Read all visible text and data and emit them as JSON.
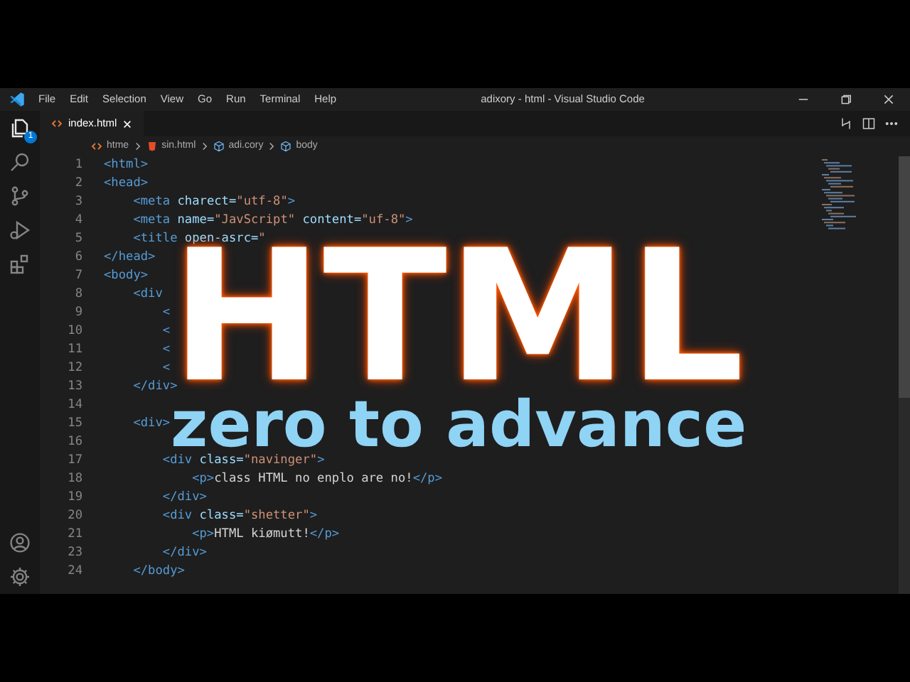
{
  "window": {
    "title": "adixory - html - Visual Studio Code"
  },
  "menu": [
    "File",
    "Edit",
    "Selection",
    "View",
    "Go",
    "Run",
    "Terminal",
    "Help"
  ],
  "activity_bar": {
    "top": [
      {
        "kind": "explorer",
        "selected": true,
        "badge": "1"
      },
      {
        "kind": "search",
        "selected": false
      },
      {
        "kind": "source-control",
        "selected": false
      },
      {
        "kind": "run",
        "selected": false
      },
      {
        "kind": "extensions",
        "selected": false
      }
    ],
    "bottom": [
      {
        "kind": "account"
      },
      {
        "kind": "settings"
      }
    ]
  },
  "tabs": [
    {
      "label": "index.html",
      "selected": true
    }
  ],
  "breadcrumb": [
    {
      "kind": "folder",
      "label": "htme"
    },
    {
      "kind": "file",
      "label": "sin.html"
    },
    {
      "kind": "symbol",
      "label": "adi.cory"
    },
    {
      "kind": "symbol",
      "label": "body"
    }
  ],
  "editor": {
    "lines": [
      {
        "number": "1",
        "tokens": [
          {
            "kind": "tag",
            "text": "<html>"
          }
        ]
      },
      {
        "number": "2",
        "tokens": [
          {
            "kind": "tag",
            "text": "<head>"
          }
        ]
      },
      {
        "number": "3",
        "tokens": [
          {
            "kind": "tag",
            "text": "    <meta"
          },
          {
            "kind": "attr",
            "text": " charect="
          },
          {
            "kind": "str",
            "text": "\"utf-8\""
          },
          {
            "kind": "tag",
            "text": ">"
          }
        ]
      },
      {
        "number": "4",
        "tokens": [
          {
            "kind": "tag",
            "text": "    <meta"
          },
          {
            "kind": "attr",
            "text": " name="
          },
          {
            "kind": "str",
            "text": "\"JavScript\""
          },
          {
            "kind": "attr",
            "text": " content="
          },
          {
            "kind": "str",
            "text": "\"uf-8\""
          },
          {
            "kind": "tag",
            "text": ">"
          }
        ]
      },
      {
        "number": "5",
        "tokens": [
          {
            "kind": "tag",
            "text": "    <title"
          },
          {
            "kind": "attr",
            "text": " open-asrc="
          },
          {
            "kind": "str",
            "text": "\""
          }
        ]
      },
      {
        "number": "6",
        "tokens": [
          {
            "kind": "tag",
            "text": "</head>"
          }
        ]
      },
      {
        "number": "7",
        "tokens": [
          {
            "kind": "tag",
            "text": "<body>"
          }
        ]
      },
      {
        "number": "8",
        "tokens": [
          {
            "kind": "tag",
            "text": "    <div"
          }
        ]
      },
      {
        "number": "9",
        "tokens": [
          {
            "kind": "tag",
            "text": "        <"
          }
        ]
      },
      {
        "number": "10",
        "tokens": [
          {
            "kind": "tag",
            "text": "        <"
          }
        ]
      },
      {
        "number": "11",
        "tokens": [
          {
            "kind": "tag",
            "text": "        <"
          }
        ]
      },
      {
        "number": "12",
        "tokens": [
          {
            "kind": "tag",
            "text": "        <"
          }
        ]
      },
      {
        "number": "13",
        "tokens": [
          {
            "kind": "tag",
            "text": "    </div>"
          }
        ]
      },
      {
        "number": "14"
      },
      {
        "number": "15",
        "tokens": [
          {
            "kind": "tag",
            "text": "    <div>"
          }
        ]
      },
      {
        "number": "16"
      },
      {
        "number": "17",
        "tokens": [
          {
            "kind": "tag",
            "text": "        <div"
          },
          {
            "kind": "attr",
            "text": " class="
          },
          {
            "kind": "str",
            "text": "\"navinger\""
          },
          {
            "kind": "tag",
            "text": ">"
          }
        ]
      },
      {
        "number": "18",
        "tokens": [
          {
            "kind": "tag",
            "text": "            <p>"
          },
          {
            "kind": "text",
            "text": "class HTML no enplo are no!"
          },
          {
            "kind": "tag",
            "text": "</p>"
          }
        ]
      },
      {
        "number": "19",
        "tokens": [
          {
            "kind": "tag",
            "text": "        </div>"
          }
        ]
      },
      {
        "number": "20",
        "tokens": [
          {
            "kind": "tag",
            "text": "        <div"
          },
          {
            "kind": "attr",
            "text": " class="
          },
          {
            "kind": "str",
            "text": "\"shetter\""
          },
          {
            "kind": "tag",
            "text": ">"
          }
        ]
      },
      {
        "number": "21",
        "tokens": [
          {
            "kind": "tag",
            "text": "            <p>"
          },
          {
            "kind": "text",
            "text": "HTML kiømutt!"
          },
          {
            "kind": "tag",
            "text": "</p>"
          }
        ]
      },
      {
        "number": "23",
        "tokens": [
          {
            "kind": "tag",
            "text": "        </div>"
          }
        ]
      },
      {
        "number": "24",
        "tokens": [
          {
            "kind": "tag",
            "text": "    </body>"
          }
        ]
      }
    ]
  },
  "overlay": {
    "title": "HTML",
    "subtitle": "zero to advance"
  }
}
